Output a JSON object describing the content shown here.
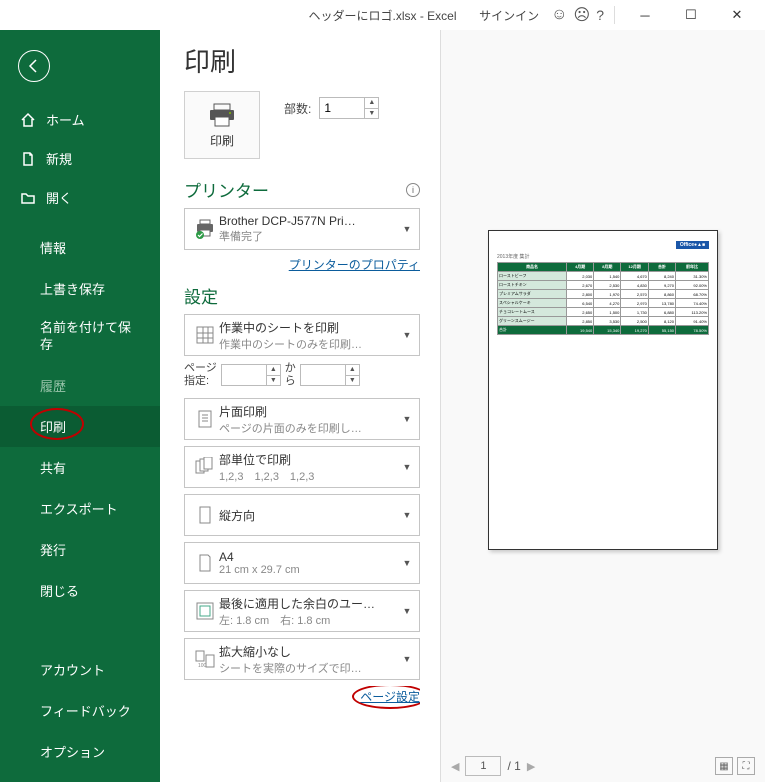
{
  "titlebar": {
    "filename": "ヘッダーにロゴ.xlsx - Excel",
    "signin": "サインイン"
  },
  "sidebar": {
    "home": "ホーム",
    "new": "新規",
    "open": "開く",
    "info": "情報",
    "save": "上書き保存",
    "saveas": "名前を付けて保存",
    "history": "履歴",
    "print": "印刷",
    "share": "共有",
    "export": "エクスポート",
    "publish": "発行",
    "close": "閉じる",
    "account": "アカウント",
    "feedback": "フィードバック",
    "options": "オプション"
  },
  "main": {
    "title": "印刷",
    "print_btn": "印刷",
    "copies_label": "部数:",
    "copies_value": "1",
    "printer_head": "プリンター",
    "printer": {
      "name": "Brother DCP-J577N Pri…",
      "status": "準備完了"
    },
    "printer_props": "プリンターのプロパティ",
    "settings_head": "設定",
    "scope": {
      "title": "作業中のシートを印刷",
      "sub": "作業中のシートのみを印刷…"
    },
    "pages_label1": "ページ",
    "pages_label2": "指定:",
    "pages_to": "か\nら",
    "sides": {
      "title": "片面印刷",
      "sub": "ページの片面のみを印刷し…"
    },
    "collate": {
      "title": "部単位で印刷",
      "sub": "1,2,3　1,2,3　1,2,3"
    },
    "orient": {
      "title": "縦方向",
      "sub": ""
    },
    "paper": {
      "title": "A4",
      "sub": "21 cm x 29.7 cm"
    },
    "margins": {
      "title": "最後に適用した余白のユー…",
      "sub": "左: 1.8 cm　右: 1.8 cm"
    },
    "scaling": {
      "title": "拡大縮小なし",
      "sub": "シートを実際のサイズで印…"
    },
    "page_setup": "ページ設定"
  },
  "preview": {
    "logo": "Office●▲■",
    "subtitle": "2013年度 集計",
    "headers": [
      "商品名",
      "4月期",
      "8月期",
      "12月期",
      "合計",
      "前年比"
    ],
    "rows": [
      [
        "ローストビーフ",
        "2,030",
        "1,540",
        "4,670",
        "8,240",
        "31.30%"
      ],
      [
        "ローストチキン",
        "2,670",
        "2,530",
        "4,830",
        "9,270",
        "92.00%"
      ],
      [
        "プレミアムサラダ",
        "2,800",
        "1,970",
        "2,570",
        "8,860",
        "68.70%"
      ],
      [
        "スペシャルケーキ",
        "6,540",
        "4,270",
        "2,970",
        "13,780",
        "74.40%"
      ],
      [
        "チョコレートムース",
        "2,650",
        "1,500",
        "1,730",
        "6,880",
        "113.20%"
      ],
      [
        "グリーンスムージー",
        "2,850",
        "3,530",
        "2,500",
        "8,120",
        "91.40%"
      ],
      [
        "合計",
        "19,540",
        "15,340",
        "19,270",
        "55,150",
        "78.50%"
      ]
    ],
    "page_current": "1",
    "page_total": "1"
  }
}
